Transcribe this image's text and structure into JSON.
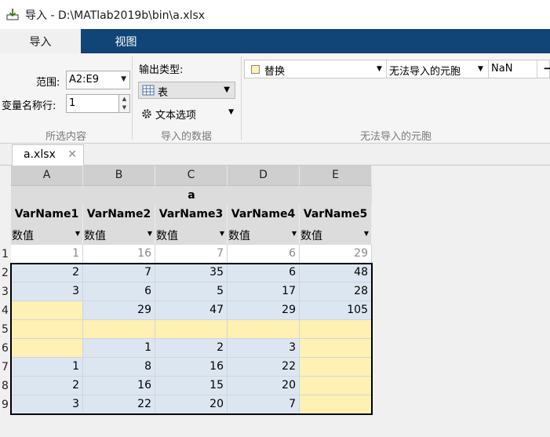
{
  "window": {
    "title": "导入 - D:\\MATlab2019b\\bin\\a.xlsx"
  },
  "ribbon_tabs": [
    {
      "label": "导入"
    },
    {
      "label": "视图"
    }
  ],
  "selection": {
    "range_label": "范围:",
    "range_value": "A2:E9",
    "varname_row_label": "变量名称行:",
    "varname_row_value": "1",
    "section_label": "所选内容"
  },
  "imported_data": {
    "output_type_label": "输出类型:",
    "output_type_value": "表",
    "text_options_label": "文本选项",
    "section_label": "导入的数据"
  },
  "unimportable": {
    "action": "替换",
    "condition": "无法导入的元胞",
    "value": "NaN",
    "remove_symbol": "−",
    "section_label": "无法导入的元胞",
    "swatch_color": "#fff3b8"
  },
  "doc_tab": {
    "label": "a.xlsx",
    "close_symbol": "✕"
  },
  "grid": {
    "columns": [
      "A",
      "B",
      "C",
      "D",
      "E"
    ],
    "table_name": "a",
    "var_names": [
      "VarName1",
      "VarName2",
      "VarName3",
      "VarName4",
      "VarName5"
    ],
    "var_type": "数值",
    "row_numbers": [
      "1",
      "2",
      "3",
      "4",
      "5",
      "6",
      "7",
      "8",
      "9"
    ],
    "rows": [
      [
        "1",
        "16",
        "7",
        "6",
        "29"
      ],
      [
        "2",
        "7",
        "35",
        "6",
        "48"
      ],
      [
        "3",
        "6",
        "5",
        "17",
        "28"
      ],
      [
        "",
        "29",
        "47",
        "29",
        "105"
      ],
      [
        "",
        "",
        "",
        "",
        ""
      ],
      [
        "",
        "1",
        "2",
        "3",
        ""
      ],
      [
        "1",
        "8",
        "16",
        "22",
        ""
      ],
      [
        "2",
        "16",
        "15",
        "20",
        ""
      ],
      [
        "3",
        "22",
        "20",
        "7",
        ""
      ]
    ],
    "colors": {
      "imported": "#dce6f1",
      "unimportable": "#fff0b3",
      "header_row": "#ffffff"
    }
  }
}
